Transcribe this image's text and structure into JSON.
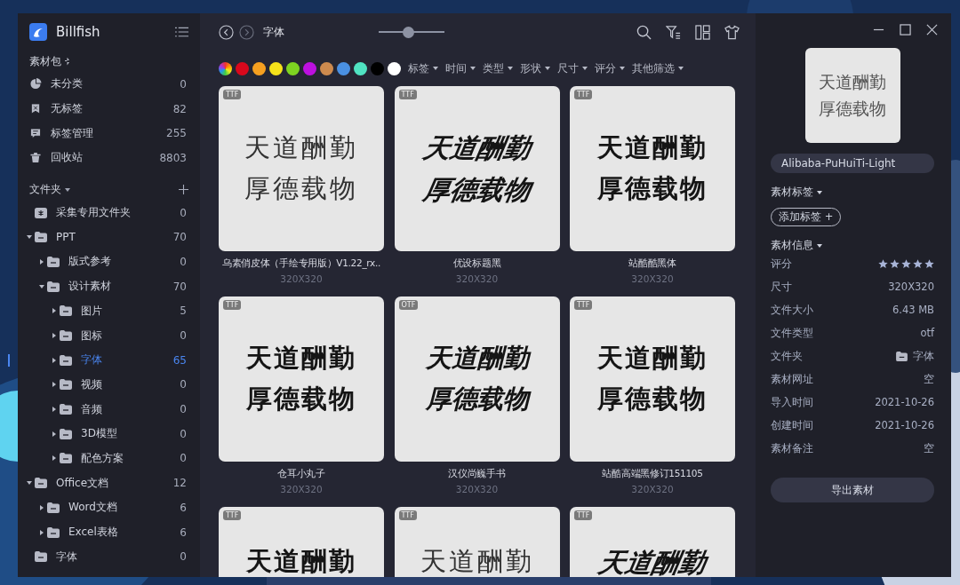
{
  "app": {
    "name": "Billfish"
  },
  "library": {
    "title": "素材包",
    "items": [
      {
        "kind": "pie",
        "label": "未分类",
        "count": "0"
      },
      {
        "kind": "untagged",
        "label": "无标签",
        "count": "82"
      },
      {
        "kind": "tags",
        "label": "标签管理",
        "count": "255"
      },
      {
        "kind": "trash",
        "label": "回收站",
        "count": "8803"
      }
    ]
  },
  "folders": {
    "title": "文件夹",
    "items": [
      {
        "kind": "collect",
        "label": "采集专用文件夹",
        "count": "0",
        "expandable": false,
        "selected": false
      },
      {
        "kind": "folder",
        "label": "PPT",
        "count": "70",
        "expandable": true,
        "expanded": true,
        "selected": false,
        "children": [
          {
            "kind": "folder",
            "label": "版式参考",
            "count": "0",
            "expandable": true,
            "expanded": false,
            "selected": false
          },
          {
            "kind": "folder",
            "label": "设计素材",
            "count": "70",
            "expandable": true,
            "expanded": true,
            "selected": false,
            "children": [
              {
                "kind": "folder",
                "label": "图片",
                "count": "5",
                "expandable": true,
                "expanded": false,
                "selected": false
              },
              {
                "kind": "folder",
                "label": "图标",
                "count": "0",
                "expandable": true,
                "expanded": false,
                "selected": false
              },
              {
                "kind": "folder",
                "label": "字体",
                "count": "65",
                "expandable": true,
                "expanded": false,
                "selected": true
              },
              {
                "kind": "folder",
                "label": "视频",
                "count": "0",
                "expandable": true,
                "expanded": false,
                "selected": false
              },
              {
                "kind": "folder",
                "label": "音频",
                "count": "0",
                "expandable": true,
                "expanded": false,
                "selected": false
              },
              {
                "kind": "folder",
                "label": "3D模型",
                "count": "0",
                "expandable": true,
                "expanded": false,
                "selected": false
              },
              {
                "kind": "folder",
                "label": "配色方案",
                "count": "0",
                "expandable": true,
                "expanded": false,
                "selected": false
              }
            ]
          }
        ]
      },
      {
        "kind": "folder",
        "label": "Office文档",
        "count": "12",
        "expandable": true,
        "expanded": true,
        "selected": false,
        "children": [
          {
            "kind": "folder",
            "label": "Word文档",
            "count": "6",
            "expandable": true,
            "expanded": false,
            "selected": false
          },
          {
            "kind": "folder",
            "label": "Excel表格",
            "count": "6",
            "expandable": true,
            "expanded": false,
            "selected": false
          }
        ]
      },
      {
        "kind": "folder",
        "label": "字体",
        "count": "0",
        "expandable": false,
        "selected": false
      }
    ]
  },
  "toolbar": {
    "path": "字体",
    "zoom": {
      "level": 0.45
    }
  },
  "filters": {
    "colors": [
      {
        "kind": "rainbow"
      },
      {
        "kind": "solid",
        "color": "#d9081c"
      },
      {
        "kind": "solid",
        "color": "#f6a020"
      },
      {
        "kind": "solid",
        "color": "#f5e21a"
      },
      {
        "kind": "solid",
        "color": "#7ed321"
      },
      {
        "kind": "solid",
        "color": "#bd10e0"
      },
      {
        "kind": "solid",
        "color": "#cd8a4e"
      },
      {
        "kind": "solid",
        "color": "#4a90e2"
      },
      {
        "kind": "solid",
        "color": "#50e3c2"
      },
      {
        "kind": "solid",
        "color": "#000000"
      },
      {
        "kind": "solid",
        "color": "#ffffff"
      }
    ],
    "menus": [
      "标签",
      "时间",
      "类型",
      "形状",
      "尺寸",
      "评分",
      "其他筛选"
    ]
  },
  "cards": [
    {
      "badge": "TTF",
      "kind": "hand",
      "lines": [
        "天道酬勤",
        "厚德载物"
      ],
      "name": "乌素俏皮体（手绘专用版）V1.22_rx..",
      "size": "320X320"
    },
    {
      "badge": "TTF",
      "kind": "italic-heavy",
      "lines": [
        "天道酬勤",
        "厚德载物"
      ],
      "name": "优设标题黑",
      "size": "320X320"
    },
    {
      "badge": "TTF",
      "kind": "heavy",
      "lines": [
        "天道酬勤",
        "厚德载物"
      ],
      "name": "站酷酷黑体",
      "size": "320X320"
    },
    {
      "badge": "TTF",
      "kind": "heavy",
      "lines": [
        "天道酬勤",
        "厚德载物"
      ],
      "name": "仓耳小丸子",
      "size": "320X320"
    },
    {
      "badge": "OTF",
      "kind": "brush",
      "lines": [
        "天道酬勤",
        "厚德载物"
      ],
      "name": "汉仪尚巍手书",
      "size": "320X320"
    },
    {
      "badge": "TTF",
      "kind": "bold",
      "lines": [
        "天道酬勤",
        "厚德载物"
      ],
      "name": "站酷高端黑修订151105",
      "size": "320X320"
    },
    {
      "badge": "TTF",
      "kind": "heavy",
      "lines": [
        "天道酬勤"
      ]
    },
    {
      "badge": "TTF",
      "kind": "hand",
      "lines": [
        "天道酬勤"
      ]
    },
    {
      "badge": "TTF",
      "kind": "italic-heavy",
      "lines": [
        "天道酬勤"
      ]
    }
  ],
  "detail": {
    "preview": [
      "天道酬勤",
      "厚德载物"
    ],
    "name": "Alibaba-PuHuiTi-Light",
    "tags_title": "素材标签",
    "add_tag": "添加标签",
    "plus": "+",
    "info_title": "素材信息",
    "rating_label": "评分",
    "stars": 5,
    "info": [
      {
        "label": "尺寸",
        "value": "320X320",
        "kind": "text"
      },
      {
        "label": "文件大小",
        "value": "6.43 MB",
        "kind": "text"
      },
      {
        "label": "文件类型",
        "value": "otf",
        "kind": "text"
      },
      {
        "label": "文件夹",
        "value": "字体",
        "kind": "folder"
      },
      {
        "label": "素材网址",
        "value": "空",
        "kind": "text"
      },
      {
        "label": "导入时间",
        "value": "2021-10-26",
        "kind": "text"
      },
      {
        "label": "创建时间",
        "value": "2021-10-26",
        "kind": "text"
      },
      {
        "label": "素材备注",
        "value": "空",
        "kind": "text"
      }
    ],
    "export": "导出素材"
  }
}
